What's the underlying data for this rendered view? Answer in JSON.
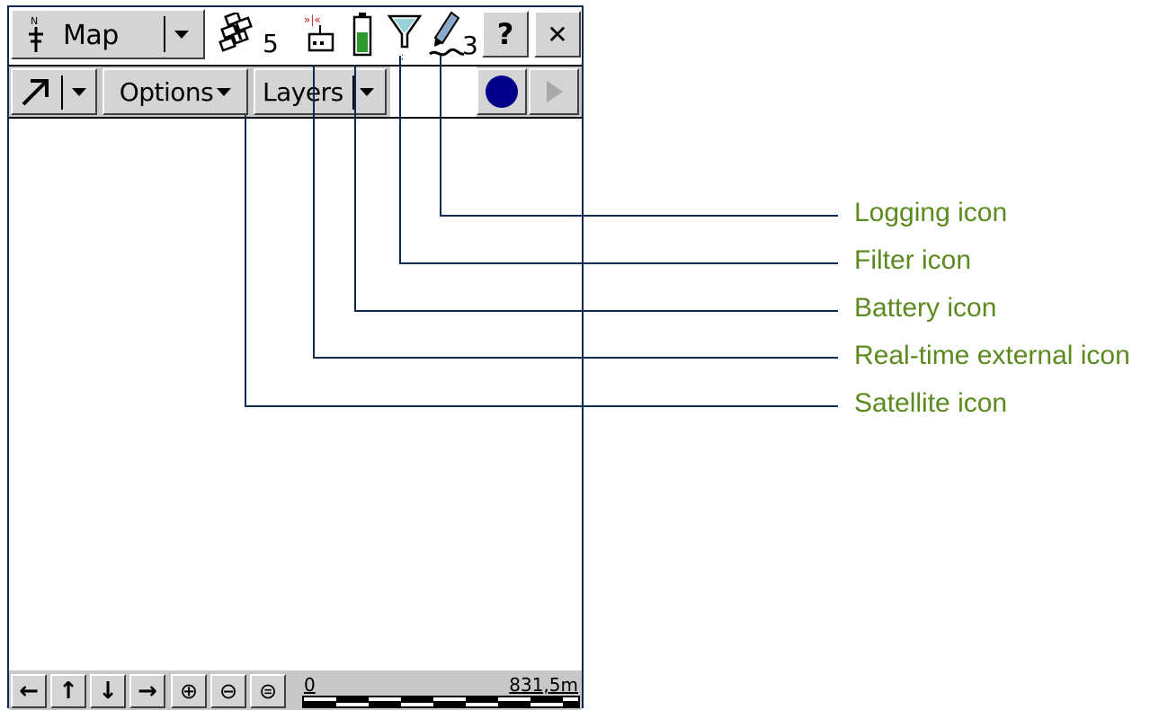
{
  "app": {
    "view_selector_label": "Map",
    "satellite_count": "5",
    "log_count": "3",
    "help_label": "?",
    "close_label": "✕"
  },
  "toolbar": {
    "options_label": "Options",
    "layers_label": "Layers"
  },
  "scale": {
    "start": "0",
    "end": "831,5m"
  },
  "callouts": {
    "logging": "Logging icon",
    "filter": "Filter icon",
    "battery": "Battery icon",
    "realtime": "Real-time external icon",
    "satellite": "Satellite icon"
  },
  "colors": {
    "callout_text": "#5b8a1f",
    "leader_line": "#0c2a52",
    "record_button": "#00008b",
    "battery_fill": "#2e9a2e"
  },
  "icons": {
    "satellite": "satellite-icon",
    "realtime": "realtime-external-icon",
    "battery": "battery-icon",
    "filter": "filter-icon",
    "logging": "logging-icon"
  }
}
